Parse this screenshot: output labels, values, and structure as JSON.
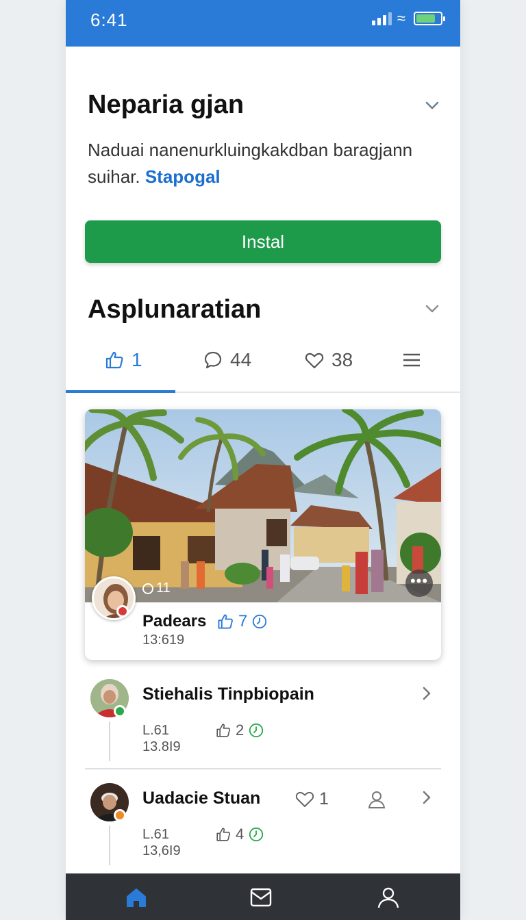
{
  "status_bar": {
    "time": "6:41",
    "icons": [
      "signal-icon",
      "wifi-icon",
      "battery-icon"
    ],
    "color": "#2a7bd8"
  },
  "app_section": {
    "title": "Neparia gjan",
    "description": "Naduai nanenurkluingkakdban baragjann suihar.",
    "link_text": "Stapogal",
    "install_label": "Instal",
    "install_color": "#1d9a4a"
  },
  "updates_section": {
    "title": "Asplunaratian"
  },
  "tabs": [
    {
      "icon": "thumbs-up-icon",
      "count": "1",
      "active": true
    },
    {
      "icon": "comment-icon",
      "count": "44",
      "active": false
    },
    {
      "icon": "heart-icon",
      "count": "38",
      "active": false
    },
    {
      "icon": "menu-icon",
      "count": "",
      "active": false
    }
  ],
  "featured_post": {
    "views": "11",
    "author": "Padears",
    "likes": "7",
    "time": "13:619",
    "image": "village-street-photo"
  },
  "list": [
    {
      "name": "Stiehalis Tinpbiopain",
      "meta1": "L.61",
      "meta2": "13.8I9",
      "likes": "2",
      "badge_color": "#2aa84a"
    },
    {
      "name": "Uadacie Stuan",
      "meta1": "L.61",
      "meta2": "13,6I9",
      "likes": "4",
      "hearts": "1",
      "badge_color": "#f08a24"
    }
  ],
  "bottom_nav": [
    "home-icon",
    "mail-icon",
    "profile-icon"
  ]
}
